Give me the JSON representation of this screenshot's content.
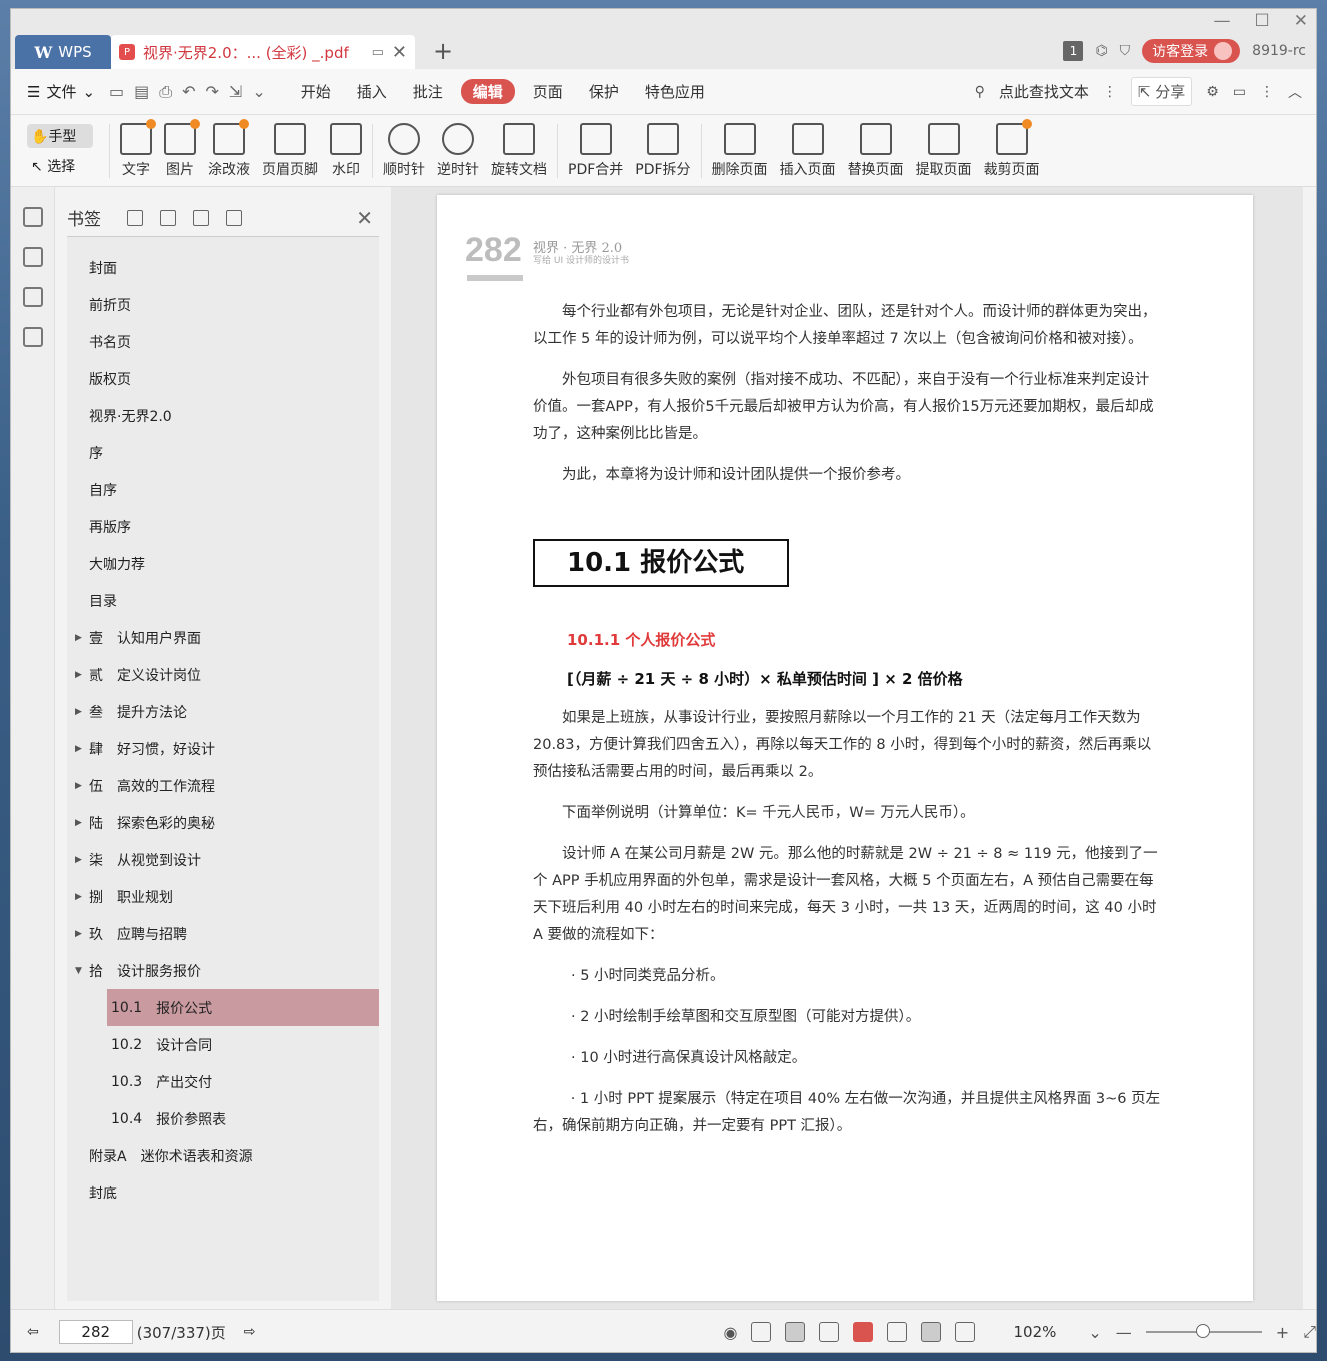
{
  "app": {
    "logo": "W",
    "name": "WPS"
  },
  "tab": {
    "title": "视界·无界2.0：... (全彩) _.pdf"
  },
  "window": {
    "min": "—",
    "max": "☐",
    "close": "✕"
  },
  "titlebar_right": {
    "page_badge": "1",
    "login": "访客登录",
    "version": "8919-rc"
  },
  "menu": {
    "file": "文件",
    "tabs": [
      "开始",
      "插入",
      "批注",
      "编辑",
      "页面",
      "保护",
      "特色应用"
    ],
    "active": "编辑",
    "search": "点此查找文本",
    "share": "分享"
  },
  "ribbon": {
    "hand": "手型",
    "select": "选择",
    "buttons": [
      "文字",
      "图片",
      "涂改液",
      "页眉页脚",
      "水印",
      "顺时针",
      "逆时针",
      "旋转文档",
      "PDF合并",
      "PDF拆分",
      "删除页面",
      "插入页面",
      "替换页面",
      "提取页面",
      "裁剪页面"
    ]
  },
  "bookmarks": {
    "title": "书签",
    "items": [
      {
        "label": "封面"
      },
      {
        "label": "前折页"
      },
      {
        "label": "书名页"
      },
      {
        "label": "版权页"
      },
      {
        "label": "视界·无界2.0"
      },
      {
        "label": "序"
      },
      {
        "label": "自序"
      },
      {
        "label": "再版序"
      },
      {
        "label": "大咖力荐"
      },
      {
        "label": "目录"
      },
      {
        "num": "壹",
        "label": "认知用户界面"
      },
      {
        "num": "贰",
        "label": "定义设计岗位"
      },
      {
        "num": "叁",
        "label": "提升方法论"
      },
      {
        "num": "肆",
        "label": "好习惯，好设计"
      },
      {
        "num": "伍",
        "label": "高效的工作流程"
      },
      {
        "num": "陆",
        "label": "探索色彩的奥秘"
      },
      {
        "num": "柒",
        "label": "从视觉到设计"
      },
      {
        "num": "捌",
        "label": "职业规划"
      },
      {
        "num": "玖",
        "label": "应聘与招聘"
      },
      {
        "num": "拾",
        "label": "设计服务报价"
      },
      {
        "num": "10.1",
        "label": "报价公式"
      },
      {
        "num": "10.2",
        "label": "设计合同"
      },
      {
        "num": "10.3",
        "label": "产出交付"
      },
      {
        "num": "10.4",
        "label": "报价参照表"
      },
      {
        "num": "附录A",
        "label": "迷你术语表和资源"
      },
      {
        "label": "封底"
      }
    ]
  },
  "page": {
    "number": "282",
    "book_title": "视界 · 无界 2.0",
    "book_subtitle": "写给 UI 设计师的设计书",
    "p1": "每个行业都有外包项目，无论是针对企业、团队，还是针对个人。而设计师的群体更为突出，以工作 5 年的设计师为例，可以说平均个人接单率超过 7 次以上（包含被询问价格和被对接）。",
    "p2": "外包项目有很多失败的案例（指对接不成功、不匹配），来自于没有一个行业标准来判定设计价值。一套APP，有人报价5千元最后却被甲方认为价高，有人报价15万元还要加期权，最后却成功了，这种案例比比皆是。",
    "p3": "为此，本章将为设计师和设计团队提供一个报价参考。",
    "section": "10.1  报价公式",
    "subsection": "10.1.1   个人报价公式",
    "formula": "[（月薪 ÷ 21 天 ÷ 8 小时）× 私单预估时间 ] × 2 倍价格",
    "p4": "如果是上班族，从事设计行业，要按照月薪除以一个月工作的 21 天（法定每月工作天数为 20.83，方便计算我们四舍五入），再除以每天工作的 8 小时，得到每个小时的薪资，然后再乘以预估接私活需要占用的时间，最后再乘以 2。",
    "p5": "下面举例说明（计算单位：K= 千元人民币，W= 万元人民币）。",
    "p6": "设计师 A 在某公司月薪是 2W 元。那么他的时薪就是 2W ÷ 21 ÷ 8 ≈ 119 元，他接到了一个 APP 手机应用界面的外包单，需求是设计一套风格，大概 5 个页面左右，A 预估自己需要在每天下班后利用 40 小时左右的时间来完成，每天 3 小时，一共 13 天，近两周的时间，这 40 小时 A 要做的流程如下：",
    "b1": "· 5 小时同类竞品分析。",
    "b2": "· 2 小时绘制手绘草图和交互原型图（可能对方提供）。",
    "b3": "· 10 小时进行高保真设计风格敲定。",
    "b4": "· 1 小时 PPT 提案展示（特定在项目 40% 左右做一次沟通，并且提供主风格界面 3~6 页左右，确保前期方向正确，并一定要有 PPT 汇报）。"
  },
  "status": {
    "page_input": "282",
    "page_total": "(307/337)页",
    "zoom": "102%"
  }
}
